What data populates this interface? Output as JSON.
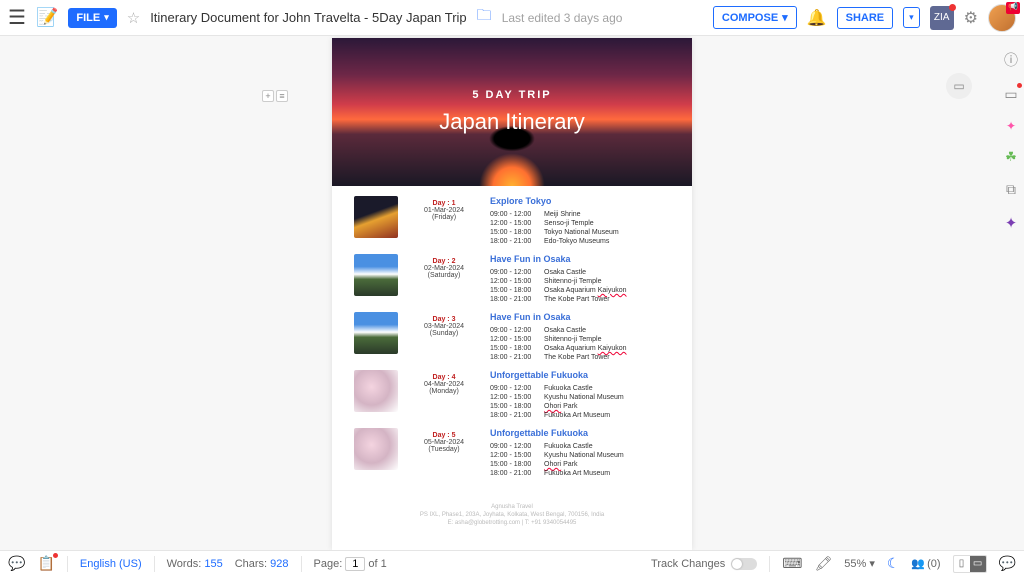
{
  "topbar": {
    "file_label": "FILE",
    "title": "Itinerary Document for John Travelta - 5Day Japan Trip",
    "last_edited": "Last edited 3 days ago",
    "compose_label": "COMPOSE",
    "share_label": "SHARE",
    "zia_label": "ZIA"
  },
  "hero": {
    "subtitle": "5 DAY TRIP",
    "title": "Japan Itinerary"
  },
  "days": [
    {
      "thumb": "city",
      "day_label": "Day : 1",
      "date": "01-Mar-2024",
      "dow": "(Friday)",
      "title": "Explore Tokyo",
      "rows": [
        {
          "time": "09:00 - 12:00",
          "place": "Meiji Shrine"
        },
        {
          "time": "12:00 - 15:00",
          "place": "Senso-ji Temple"
        },
        {
          "time": "15:00 - 18:00",
          "place": "Tokyo National Museum"
        },
        {
          "time": "18:00 - 21:00",
          "place": "Edo-Tokyo Museums"
        }
      ]
    },
    {
      "thumb": "mtn",
      "day_label": "Day : 2",
      "date": "02-Mar-2024",
      "dow": "(Saturday)",
      "title": "Have Fun in Osaka",
      "rows": [
        {
          "time": "09:00 - 12:00",
          "place": "Osaka Castle"
        },
        {
          "time": "12:00 - 15:00",
          "place": "Shitenno-ji Temple"
        },
        {
          "time": "15:00 - 18:00",
          "place": "Osaka Aquarium ",
          "u": "Kaiyukon"
        },
        {
          "time": "18:00 - 21:00",
          "place": "The Kobe Part Tower"
        }
      ]
    },
    {
      "thumb": "mtn",
      "day_label": "Day : 3",
      "date": "03-Mar-2024",
      "dow": "(Sunday)",
      "title": "Have Fun in Osaka",
      "rows": [
        {
          "time": "09:00 - 12:00",
          "place": "Osaka Castle"
        },
        {
          "time": "12:00 - 15:00",
          "place": "Shitenno-ji Temple"
        },
        {
          "time": "15:00 - 18:00",
          "place": "Osaka Aquarium ",
          "u": "Kaiyukon"
        },
        {
          "time": "18:00 - 21:00",
          "place": "The Kobe Part Tower"
        }
      ]
    },
    {
      "thumb": "blossom",
      "day_label": "Day : 4",
      "date": "04-Mar-2024",
      "dow": "(Monday)",
      "title": "Unforgettable Fukuoka",
      "rows": [
        {
          "time": "09:00 - 12:00",
          "place": "Fukuoka Castle"
        },
        {
          "time": "12:00 - 15:00",
          "place": "Kyushu National Museum"
        },
        {
          "time": "15:00 - 18:00",
          "u": "Ohori",
          "place2": " Park"
        },
        {
          "time": "18:00 - 21:00",
          "place": "Fukuoka Art Museum"
        }
      ]
    },
    {
      "thumb": "blossom",
      "day_label": "Day : 5",
      "date": "05-Mar-2024",
      "dow": "(Tuesday)",
      "title": "Unforgettable Fukuoka",
      "rows": [
        {
          "time": "09:00 - 12:00",
          "place": "Fukuoka Castle"
        },
        {
          "time": "12:00 - 15:00",
          "place": "Kyushu National Museum"
        },
        {
          "time": "15:00 - 18:00",
          "u": "Ohori",
          "place2": " Park"
        },
        {
          "time": "18:00 - 21:00",
          "place": "Fukuoka Art Museum"
        }
      ]
    }
  ],
  "footer": {
    "l1": "Agnusha Travel",
    "l2": "PS IXL, Phase1, 203A, Joyhata, Kolkata, West Bengal, 700156, India",
    "l3": "E: asha@globetrotting.com | T: +91 9340054495"
  },
  "status": {
    "lang": "English (US)",
    "words_label": "Words:",
    "words": "155",
    "chars_label": "Chars:",
    "chars": "928",
    "page_label": "Page:",
    "page_cur": "1",
    "page_of": "of",
    "page_total": "1",
    "track": "Track Changes",
    "zoom": "55%",
    "presence": "(0)"
  }
}
